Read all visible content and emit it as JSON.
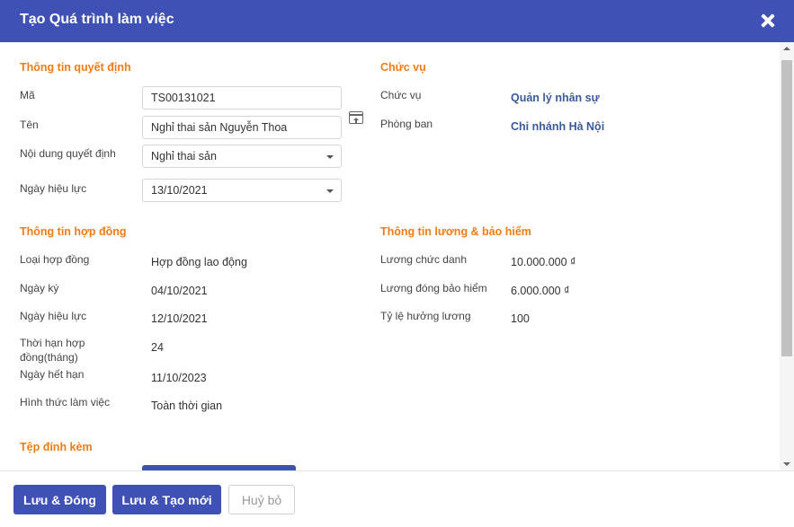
{
  "dialog": {
    "title": "Tạo Quá trình làm việc"
  },
  "decision": {
    "title": "Thông tin quyết định",
    "code_label": "Mã",
    "code_value": "TS00131021",
    "name_label": "Tên",
    "name_value": "Nghỉ thai sản Nguyễn Thoa",
    "content_label": "Nội dung quyết định",
    "content_value": "Nghỉ thai sản",
    "effective_label": "Ngày hiệu lực",
    "effective_value": "13/10/2021"
  },
  "position": {
    "title": "Chức vụ",
    "position_label": "Chức vụ",
    "position_value": "Quản lý nhân sự",
    "dept_label": "Phòng ban",
    "dept_value": "Chi nhánh Hà Nội"
  },
  "contract": {
    "title": "Thông tin hợp đồng",
    "type_label": "Loại hợp đồng",
    "type_value": "Hợp đồng lao động",
    "sign_label": "Ngày ký",
    "sign_value": "04/10/2021",
    "effective_label": "Ngày hiệu lực",
    "effective_value": "12/10/2021",
    "term_label": "Thời hạn hợp đồng(tháng)",
    "term_value": "24",
    "expiry_label": "Ngày hết hạn",
    "expiry_value": "11/10/2023",
    "mode_label": "Hình thức làm việc",
    "mode_value": "Toàn thời gian"
  },
  "salary": {
    "title": "Thông tin lương & bảo hiểm",
    "title_salary_label": "Lương chức danh",
    "title_salary_value": "10.000.000 ₫",
    "insurance_label": "Lương đóng bảo hiểm",
    "insurance_value": "6.000.000 ₫",
    "rate_label": "Tỷ lệ hưởng lương",
    "rate_value": "100"
  },
  "attachments": {
    "title": "Tệp đính kèm"
  },
  "footer": {
    "save_close": "Lưu & Đóng",
    "save_new": "Lưu & Tạo mới",
    "cancel": "Huỷ bỏ"
  },
  "colors": {
    "primary": "#3f51b5",
    "section": "#f07c16",
    "value_link": "#3b5a9a"
  },
  "icons": {
    "close": "close-icon",
    "open_list": "open-list-icon"
  }
}
